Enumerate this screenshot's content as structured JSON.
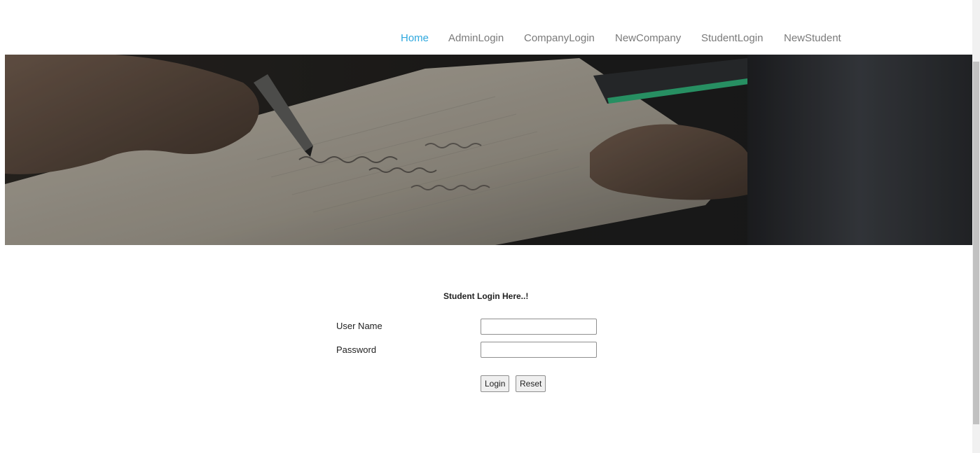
{
  "nav": {
    "items": [
      {
        "label": "Home",
        "active": true
      },
      {
        "label": "AdminLogin",
        "active": false
      },
      {
        "label": "CompanyLogin",
        "active": false
      },
      {
        "label": "NewCompany",
        "active": false
      },
      {
        "label": "StudentLogin",
        "active": false
      },
      {
        "label": "NewStudent",
        "active": false
      }
    ],
    "active_color": "#2fa8de",
    "text_color": "#7a7a7a"
  },
  "hero": {
    "image": "hand-writing-in-notebook-photo"
  },
  "login": {
    "title": "Student Login Here..!",
    "username_label": "User Name",
    "username_value": "",
    "password_label": "Password",
    "password_value": "",
    "login_button": "Login",
    "reset_button": "Reset"
  }
}
